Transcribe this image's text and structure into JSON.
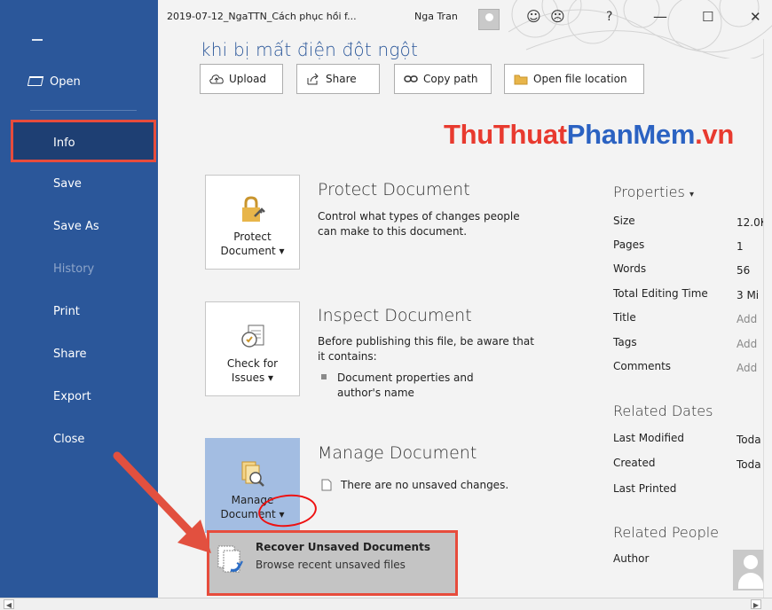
{
  "titlebar": {
    "filename": "2019-07-12_NgaTTN_Cách phục hồi f...",
    "user": "Nga Tran",
    "icons": [
      "smiley-icon",
      "frown-icon",
      "help-icon",
      "minimize-icon",
      "maximize-icon",
      "close-icon"
    ],
    "glyphs": {
      "smile": "☺",
      "frown": "☹",
      "help": "?",
      "minimize": "—",
      "maximize": "☐",
      "close": "✕"
    }
  },
  "sidebar": {
    "items": [
      {
        "label": "Open"
      },
      {
        "label": "Info"
      },
      {
        "label": "Save"
      },
      {
        "label": "Save As"
      },
      {
        "label": "History"
      },
      {
        "label": "Print"
      },
      {
        "label": "Share"
      },
      {
        "label": "Export"
      },
      {
        "label": "Close"
      }
    ]
  },
  "document": {
    "heading": "khi bị mất điện đột ngột"
  },
  "toolbar": {
    "upload": "Upload",
    "share": "Share",
    "copy_path": "Copy path",
    "open_location": "Open file location"
  },
  "watermark": {
    "part1": "ThuThuat",
    "part2": "PhanMem",
    "part3": ".vn"
  },
  "protect": {
    "button_line1": "Protect",
    "button_line2": "Document",
    "title": "Protect Document",
    "desc": "Control what types of changes people can make to this document."
  },
  "inspect": {
    "button_line1": "Check for",
    "button_line2": "Issues",
    "title": "Inspect Document",
    "desc": "Before publishing this file, be aware that it contains:",
    "bullet": "Document properties and author's name"
  },
  "manage": {
    "button_line1": "Manage",
    "button_line2": "Document",
    "title": "Manage Document",
    "status": "There are no unsaved changes."
  },
  "recover": {
    "title": "Recover Unsaved Documents",
    "subtitle": "Browse recent unsaved files"
  },
  "properties": {
    "heading": "Properties",
    "rows": [
      {
        "label": "Size",
        "value": "12.0K"
      },
      {
        "label": "Pages",
        "value": "1"
      },
      {
        "label": "Words",
        "value": "56"
      },
      {
        "label": "Total Editing Time",
        "value": "3 Mi"
      },
      {
        "label": "Title",
        "value": "Add"
      },
      {
        "label": "Tags",
        "value": "Add"
      },
      {
        "label": "Comments",
        "value": "Add"
      }
    ],
    "related_dates_heading": "Related Dates",
    "dates": [
      {
        "label": "Last Modified",
        "value": "Toda"
      },
      {
        "label": "Created",
        "value": "Toda"
      },
      {
        "label": "Last Printed",
        "value": ""
      }
    ],
    "related_people_heading": "Related People",
    "author_label": "Author"
  },
  "colors": {
    "sidebar": "#2b579a",
    "highlight": "#e74c3c",
    "accent": "#2b579a"
  }
}
